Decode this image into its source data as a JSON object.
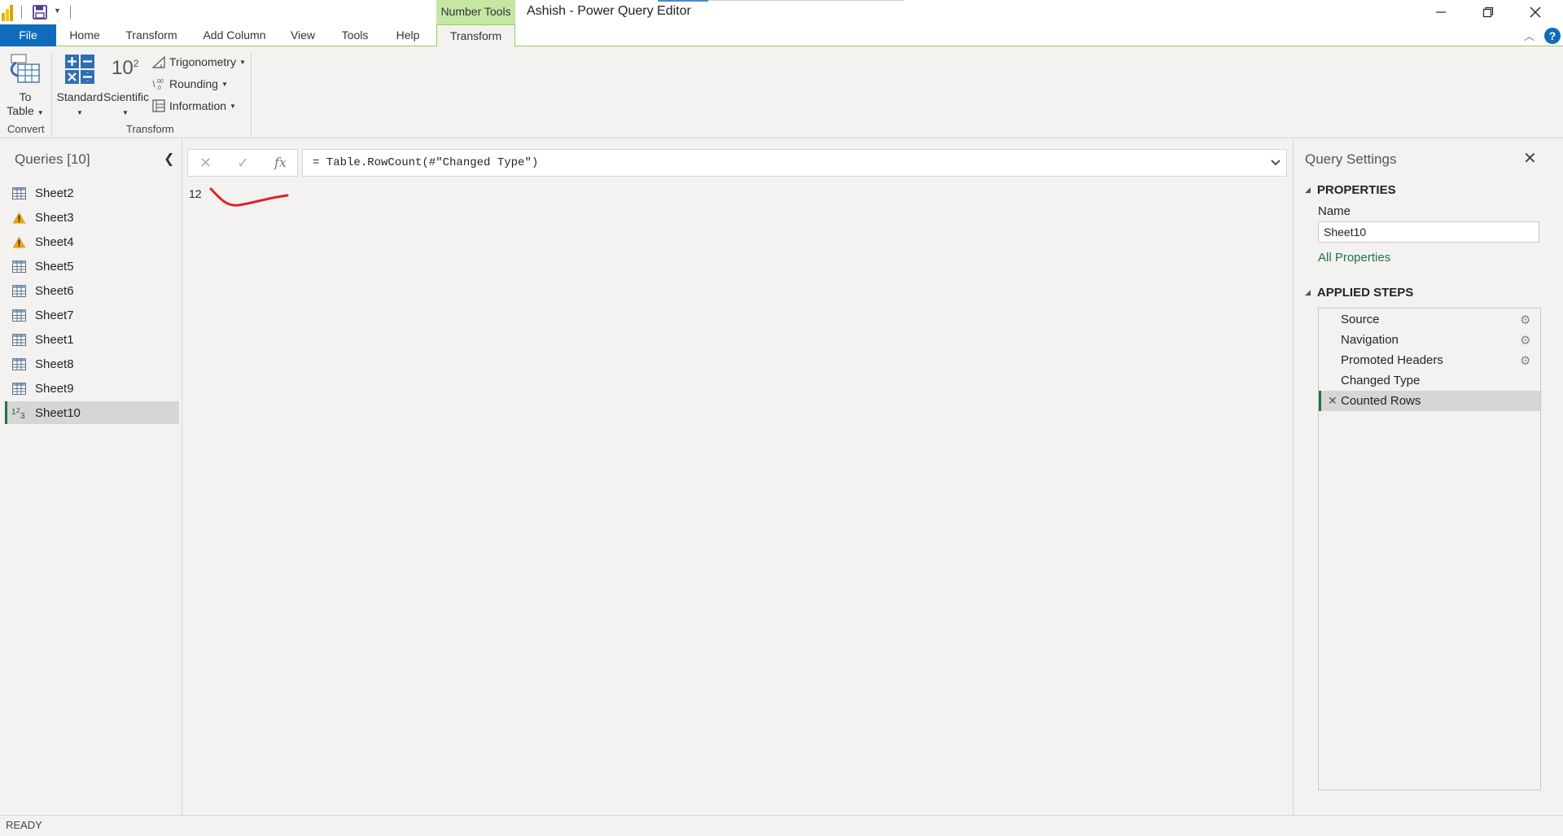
{
  "app": {
    "context_group": "Number Tools",
    "window_title": "Ashish - Power Query Editor"
  },
  "tabs": [
    {
      "label": "File"
    },
    {
      "label": "Home"
    },
    {
      "label": "Transform"
    },
    {
      "label": "Add Column"
    },
    {
      "label": "View"
    },
    {
      "label": "Tools"
    },
    {
      "label": "Help"
    },
    {
      "label": "Transform"
    }
  ],
  "ribbon": {
    "to_table_line1": "To",
    "to_table_line2": "Table",
    "standard": "Standard",
    "scientific": "Scientific",
    "scientific_icon_base": "10",
    "scientific_icon_exp": "2",
    "trigonometry": "Trigonometry",
    "rounding": "Rounding",
    "information": "Information",
    "groups": {
      "convert": "Convert",
      "transform": "Transform"
    }
  },
  "queries": {
    "title": "Queries [10]",
    "items": [
      {
        "label": "Sheet2",
        "icon": "table-icon"
      },
      {
        "label": "Sheet3",
        "icon": "warning-icon"
      },
      {
        "label": "Sheet4",
        "icon": "warning-icon"
      },
      {
        "label": "Sheet5",
        "icon": "table-icon"
      },
      {
        "label": "Sheet6",
        "icon": "table-icon"
      },
      {
        "label": "Sheet7",
        "icon": "table-icon"
      },
      {
        "label": "Sheet1",
        "icon": "table-icon"
      },
      {
        "label": "Sheet8",
        "icon": "table-icon"
      },
      {
        "label": "Sheet9",
        "icon": "table-icon"
      },
      {
        "label": "Sheet10",
        "icon": "number-123-icon",
        "selected": true
      }
    ]
  },
  "formula_bar": {
    "formula": "= Table.RowCount(#\"Changed Type\")"
  },
  "result": {
    "value": "12"
  },
  "settings": {
    "title": "Query Settings",
    "properties_header": "PROPERTIES",
    "name_label": "Name",
    "name_value": "Sheet10",
    "all_properties": "All Properties",
    "applied_steps_header": "APPLIED STEPS",
    "steps": [
      {
        "label": "Source",
        "has_gear": true
      },
      {
        "label": "Navigation",
        "has_gear": true
      },
      {
        "label": "Promoted Headers",
        "has_gear": true
      },
      {
        "label": "Changed Type",
        "has_gear": false
      },
      {
        "label": "Counted Rows",
        "has_gear": false,
        "selected": true
      }
    ]
  },
  "status": {
    "text": "READY"
  },
  "colors": {
    "accent_green": "#217346",
    "context_tab_green": "#c7e6a3",
    "file_tab_blue": "#0f6cbd",
    "annotation_red": "#e0202a",
    "warning_yellow": "#e8a317"
  }
}
